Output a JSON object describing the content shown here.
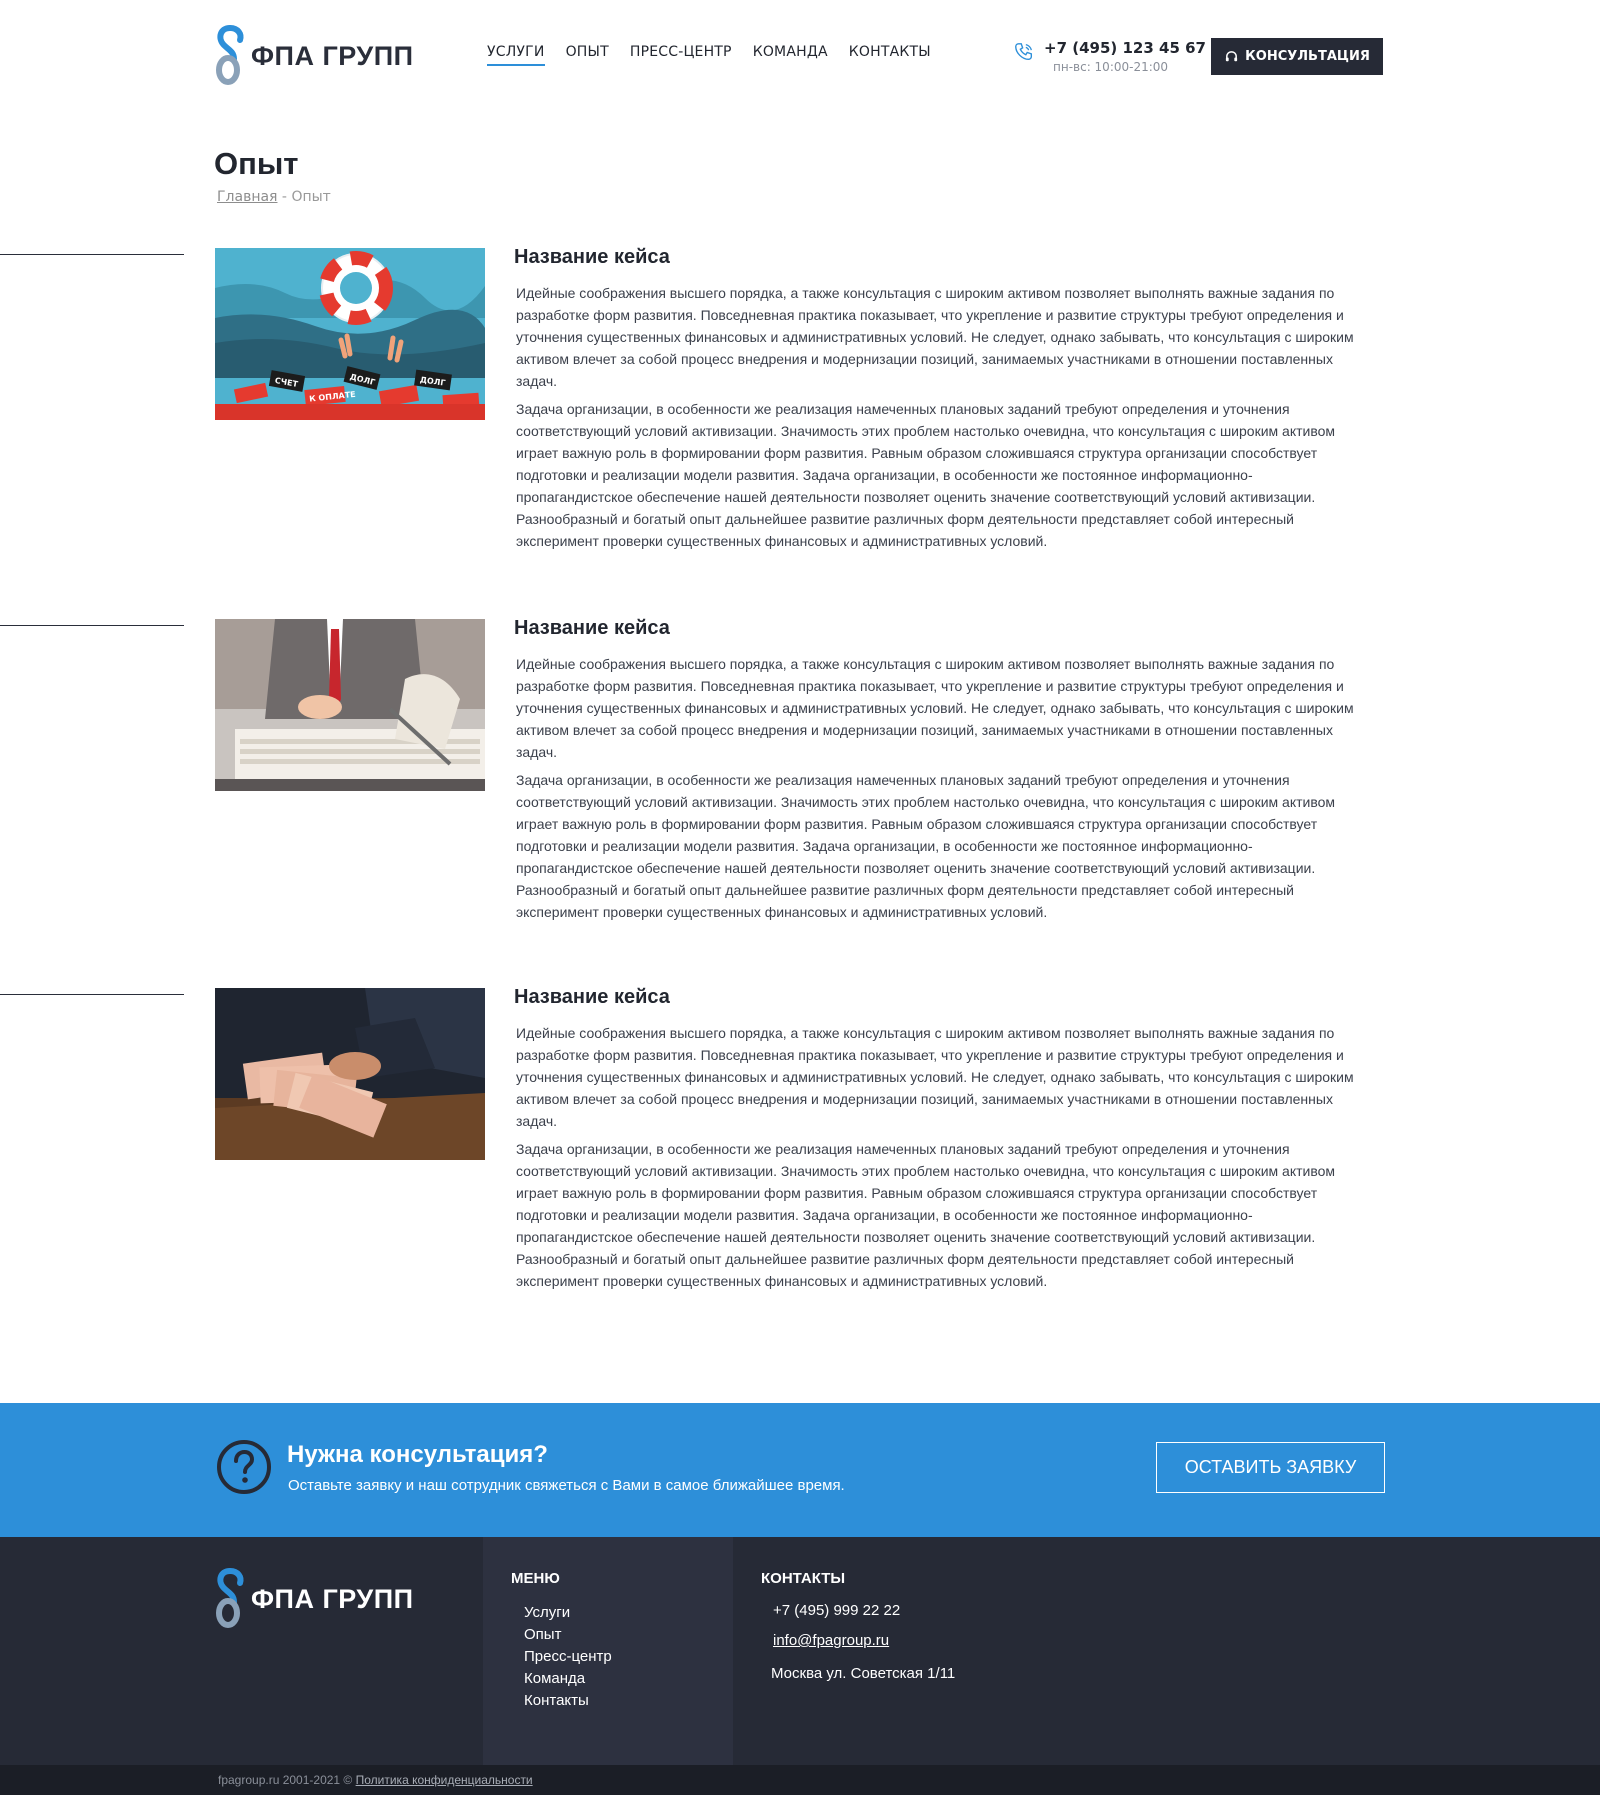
{
  "brand": {
    "name": "ФПА ГРУПП"
  },
  "nav": [
    {
      "label": "УСЛУГИ",
      "active": true
    },
    {
      "label": "ОПЫТ",
      "active": false
    },
    {
      "label": "ПРЕСС-ЦЕНТР",
      "active": false
    },
    {
      "label": "КОМАНДА",
      "active": false
    },
    {
      "label": "КОНТАКТЫ",
      "active": false
    }
  ],
  "header": {
    "phone": "+7 (495) 123 45 67",
    "hours": "пн-вс: 10:00-21:00",
    "consult_label": "КОНСУЛЬТАЦИЯ"
  },
  "page": {
    "title": "Опыт",
    "breadcrumb_home": "Главная",
    "breadcrumb_sep": " - ",
    "breadcrumb_current": "Опыт"
  },
  "cases": [
    {
      "title": "Название кейса",
      "p1": "Идейные соображения высшего порядка, а также консультация с широким активом позволяет выполнять важные задания по разработке форм развития. Повседневная практика показывает, что укрепление и развитие структуры требуют определения и уточнения существенных финансовых и административных условий. Не следует, однако забывать, что консультация с широким активом влечет за собой процесс внедрения и модернизации позиций, занимаемых участниками в отношении поставленных задач.",
      "p2": "Задача организации, в особенности же реализация намеченных плановых заданий требуют определения и уточнения соответствующий условий активизации. Значимость этих проблем настолько очевидна, что консультация с широким активом играет важную роль в формировании форм развития. Равным образом сложившаяся структура организации способствует подготовки и реализации модели развития. Задача организации, в особенности же постоянное информационно-пропагандистское обеспечение нашей деятельности позволяет оценить значение соответствующий условий активизации. Разнообразный и богатый опыт дальнейшее развитие различных форм деятельности представляет собой интересный эксперимент проверки существенных финансовых и административных условий."
    },
    {
      "title": "Название кейса",
      "p1": "Идейные соображения высшего порядка, а также консультация с широким активом позволяет выполнять важные задания по разработке форм развития. Повседневная практика показывает, что укрепление и развитие структуры требуют определения и уточнения существенных финансовых и административных условий. Не следует, однако забывать, что консультация с широким активом влечет за собой процесс внедрения и модернизации позиций, занимаемых участниками в отношении поставленных задач.",
      "p2": "Задача организации, в особенности же реализация намеченных плановых заданий требуют определения и уточнения соответствующий условий активизации. Значимость этих проблем настолько очевидна, что консультация с широким активом играет важную роль в формировании форм развития. Равным образом сложившаяся структура организации способствует подготовки и реализации модели развития. Задача организации, в особенности же постоянное информационно-пропагандистское обеспечение нашей деятельности позволяет оценить значение соответствующий условий активизации. Разнообразный и богатый опыт дальнейшее развитие различных форм деятельности представляет собой интересный эксперимент проверки существенных финансовых и административных условий."
    },
    {
      "title": "Название кейса",
      "p1": "Идейные соображения высшего порядка, а также консультация с широким активом позволяет выполнять важные задания по разработке форм развития. Повседневная практика показывает, что укрепление и развитие структуры требуют определения и уточнения существенных финансовых и административных условий. Не следует, однако забывать, что консультация с широким активом влечет за собой процесс внедрения и модернизации позиций, занимаемых участниками в отношении поставленных задач.",
      "p2": "Задача организации, в особенности же реализация намеченных плановых заданий требуют определения и уточнения соответствующий условий активизации. Значимость этих проблем настолько очевидна, что консультация с широким активом играет важную роль в формировании форм развития. Равным образом сложившаяся структура организации способствует подготовки и реализации модели развития. Задача организации, в особенности же постоянное информационно-пропагандистское обеспечение нашей деятельности позволяет оценить значение соответствующий условий активизации. Разнообразный и богатый опыт дальнейшее развитие различных форм деятельности представляет собой интересный эксперимент проверки существенных финансовых и административных условий."
    }
  ],
  "illustration_labels": [
    "ДОЛГ",
    "СЧЕТ",
    "К ОПЛАТЕ"
  ],
  "cta": {
    "title": "Нужна консультация?",
    "subtitle": "Оставьте заявку и наш сотрудник свяжеться с Вами в самое ближайшее время.",
    "button": "ОСТАВИТЬ ЗАЯВКУ"
  },
  "footer": {
    "menu_title": "МЕНЮ",
    "menu": [
      "Услуги",
      "Опыт",
      "Пресс-центр",
      "Команда",
      "Контакты"
    ],
    "contacts_title": "КОНТАКТЫ",
    "phone": "+7 (495) 999 22 22",
    "email": "info@fpagroup.ru",
    "address": "Москва ул. Советская 1/11"
  },
  "copyright": {
    "text": "fpagroup.ru 2001-2021 © ",
    "policy": "Политика конфиденциальности"
  },
  "colors": {
    "accent": "#2d8fd9",
    "dark": "#262a36"
  }
}
